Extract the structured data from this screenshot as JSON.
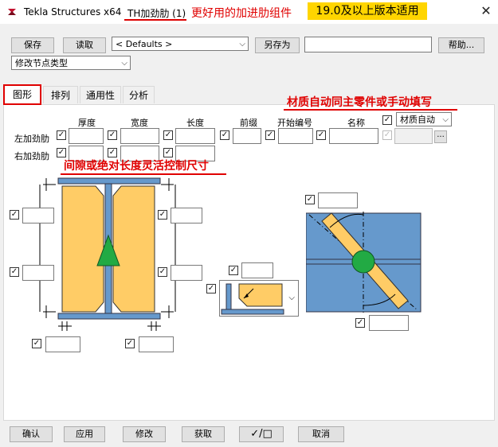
{
  "window": {
    "app_title": "Tekla Structures x64",
    "component_title": "TH加劲肋 (1)",
    "tag_red": "更好用的加进肋组件",
    "tag_yellow": "19.0及以上版本适用",
    "close_glyph": "✕"
  },
  "toolbar": {
    "save": "保存",
    "read": "读取",
    "preset": "< Defaults >",
    "save_as": "另存为",
    "save_as_value": "",
    "help": "帮助...",
    "node_type": "修改节点类型"
  },
  "tabs": [
    {
      "label": "图形"
    },
    {
      "label": "排列"
    },
    {
      "label": "通用性"
    },
    {
      "label": "分析"
    }
  ],
  "annotations": {
    "material": "材质自动同主零件或手动填写",
    "gap": "间隙或绝对长度灵活控制尺寸"
  },
  "grid": {
    "headers": [
      "厚度",
      "宽度",
      "长度",
      "前缀",
      "开始编号",
      "名称"
    ],
    "material_combo": "材质自动",
    "rows": [
      {
        "label": "左加劲肋"
      },
      {
        "label": "右加劲肋"
      }
    ]
  },
  "footer": {
    "ok": "确认",
    "apply": "应用",
    "modify": "修改",
    "get": "获取",
    "toggle": "✓/□",
    "cancel": "取消"
  },
  "colors": {
    "stiffener": "#ffcc66",
    "steel": "#6699cc",
    "arrow_green": "#22aa44",
    "annot_red": "#e00000",
    "tag_yellow": "#ffd500"
  },
  "icons": [
    "tekla-logo-icon",
    "close-icon",
    "chevron-down-icon",
    "checkbox-icon",
    "dimension-arrow-icon",
    "ellipsis-icon"
  ]
}
